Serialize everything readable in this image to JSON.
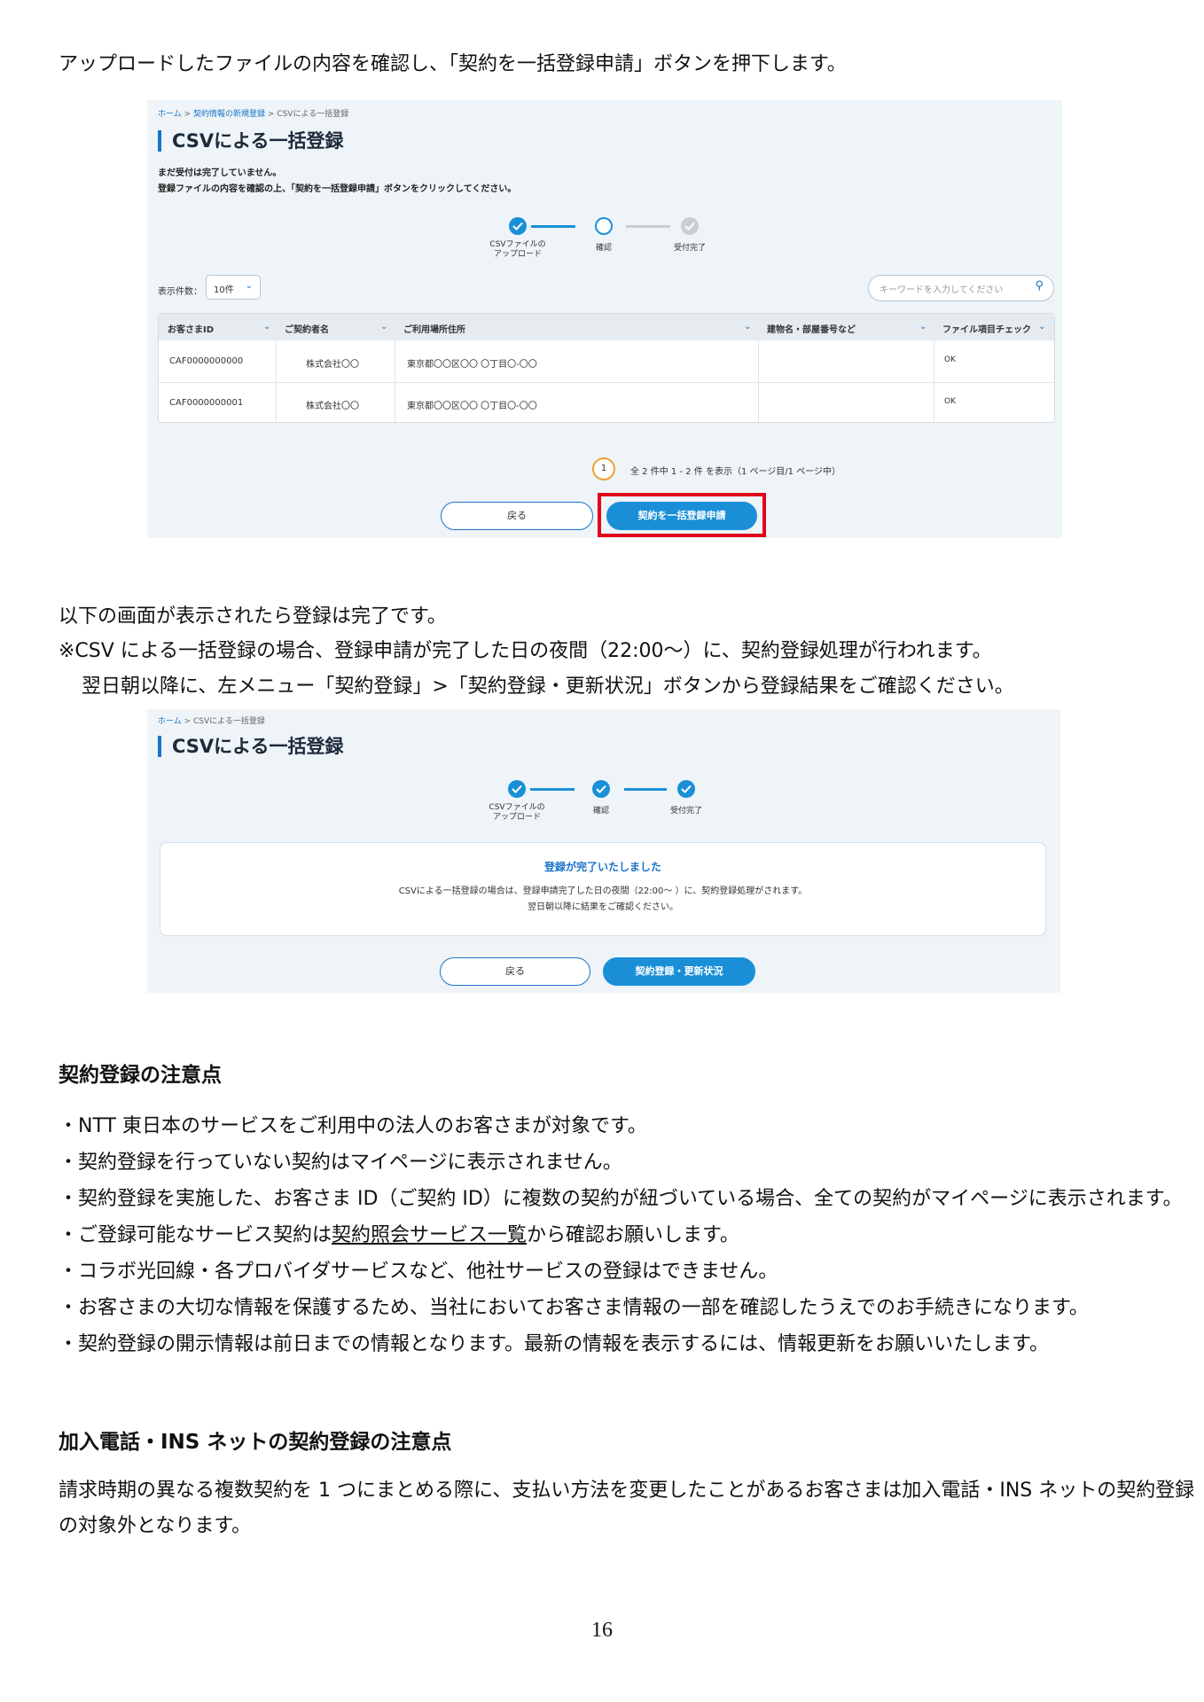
{
  "intro_text": "アップロードしたファイルの内容を確認し、「契約を一括登録申請」ボタンを押下します。",
  "screen1": {
    "breadcrumb": [
      "ホーム",
      "契約情報の新規登録",
      "CSVによる一括登録"
    ],
    "title": "CSVによる一括登録",
    "note_line1": "まだ受付は完了していません。",
    "note_line2": "登録ファイルの内容を確認の上、「契約を一括登録申請」ボタンをクリックしてください。",
    "steps": [
      "CSVファイルのアップロード",
      "確認",
      "受付完了"
    ],
    "step1_line1": "CSVファイルの",
    "step1_line2": "アップロード",
    "display_count_label": "表示件数：",
    "display_count_value": "10件",
    "search_placeholder": "キーワードを入力してください",
    "columns": [
      "お客さまID",
      "ご契約者名",
      "ご利用場所住所",
      "建物名・部屋番号など",
      "ファイル項目チェック"
    ],
    "rows": [
      {
        "id": "CAF0000000000",
        "name": "株式会社〇〇",
        "address": "東京都〇〇区〇〇 〇丁目〇-〇〇",
        "building": "",
        "check": "OK"
      },
      {
        "id": "CAF0000000001",
        "name": "株式会社〇〇",
        "address": "東京都〇〇区〇〇 〇丁目〇-〇〇",
        "building": "",
        "check": "OK"
      }
    ],
    "page_current": "1",
    "page_summary": "全 2 件中 1 - 2 件 を表示（1 ページ目/1 ページ中）",
    "back_button": "戻る",
    "submit_button": "契約を一括登録申請"
  },
  "middle_text": {
    "line1": "以下の画面が表示されたら登録は完了です。",
    "line2": "※CSV による一括登録の場合、登録申請が完了した日の夜間（22:00～）に、契約登録処理が行われます。",
    "line3": "翌日朝以降に、左メニュー「契約登録」>「契約登録・更新状況」ボタンから登録結果をご確認ください。"
  },
  "screen2": {
    "breadcrumb": [
      "ホーム",
      "CSVによる一括登録"
    ],
    "title": "CSVによる一括登録",
    "steps": [
      "CSVファイルのアップロード",
      "確認",
      "受付完了"
    ],
    "step1_line1": "CSVファイルの",
    "step1_line2": "アップロード",
    "complete_title": "登録が完了いたしました",
    "complete_line1": "CSVによる一括登録の場合は、登録申請完了した日の夜間（22:00～ ）に、契約登録処理がされます。",
    "complete_line2": "翌日朝以降に結果をご確認ください。",
    "back_button": "戻る",
    "status_button": "契約登録・更新状況"
  },
  "section1": {
    "heading": "契約登録の注意点",
    "bullets": [
      "・NTT 東日本のサービスをご利用中の法人のお客さまが対象です。",
      "・契約登録を行っていない契約はマイページに表示されません。",
      "・契約登録を実施した、お客さま ID（ご契約 ID）に複数の契約が紐づいている場合、全ての契約がマイページに表示されます。"
    ],
    "bullet4_pre": "・ご登録可能なサービス契約は",
    "bullet4_link": "契約照会サービス一覧",
    "bullet4_post": "から確認お願いします。",
    "bullets_after": [
      "・コラボ光回線・各プロバイダサービスなど、他社サービスの登録はできません。",
      "・お客さまの大切な情報を保護するため、当社においてお客さま情報の一部を確認したうえでのお手続きになります。",
      "・契約登録の開示情報は前日までの情報となります。最新の情報を表示するには、情報更新をお願いいたします。"
    ]
  },
  "section2": {
    "heading": "加入電話・INS ネットの契約登録の注意点",
    "line1": "請求時期の異なる複数契約を 1 つにまとめる際に、支払い方法を変更したことがあるお客さまは加入電話・INS ネットの契約登録",
    "line2": "の対象外となります。"
  },
  "page_number": "16",
  "colors": {
    "accent": "#1a8fd8",
    "highlight": "#e3001b",
    "panel_bg": "#eef4f8"
  }
}
